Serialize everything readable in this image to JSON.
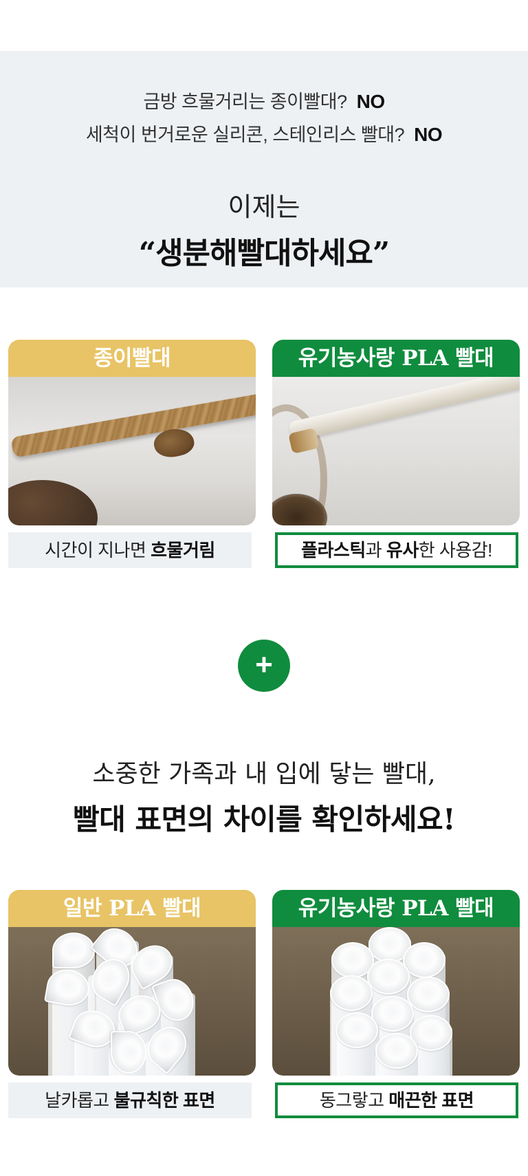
{
  "intro": {
    "line1_text": "금방 흐물거리는 종이빨대?",
    "line1_answer": "NO",
    "line2_text": "세척이 번거로운 실리콘, 스테인리스 빨대?",
    "line2_answer": "NO",
    "now_text": "이제는",
    "slogan": "“생분해빨대하세요”"
  },
  "compare1": {
    "left_label": "종이빨대",
    "right_label": "유기농사랑 PLA 빨대",
    "left_caption_plain": "시간이 지나면 ",
    "left_caption_bold": "흐물거림",
    "right_caption_bold1": "플라스틱",
    "right_caption_plain1": "과 ",
    "right_caption_bold2": "유사",
    "right_caption_plain2": "한 사용감!"
  },
  "plus_symbol": "+",
  "headline": {
    "line1": "소중한 가족과 내 입에 닿는 빨대,",
    "line2": "빨대 표면의 차이를 확인하세요!"
  },
  "compare2": {
    "left_label": "일반 PLA 빨대",
    "right_label": "유기농사랑 PLA 빨대",
    "left_caption_plain": "날카롭고 ",
    "left_caption_bold": "불규칙한 표면",
    "right_caption_plain": "동그랗고 ",
    "right_caption_bold": "매끈한 표면"
  },
  "colors": {
    "green": "#108c3e",
    "yellow": "#e8c466",
    "light_gray": "#eef1f4"
  }
}
